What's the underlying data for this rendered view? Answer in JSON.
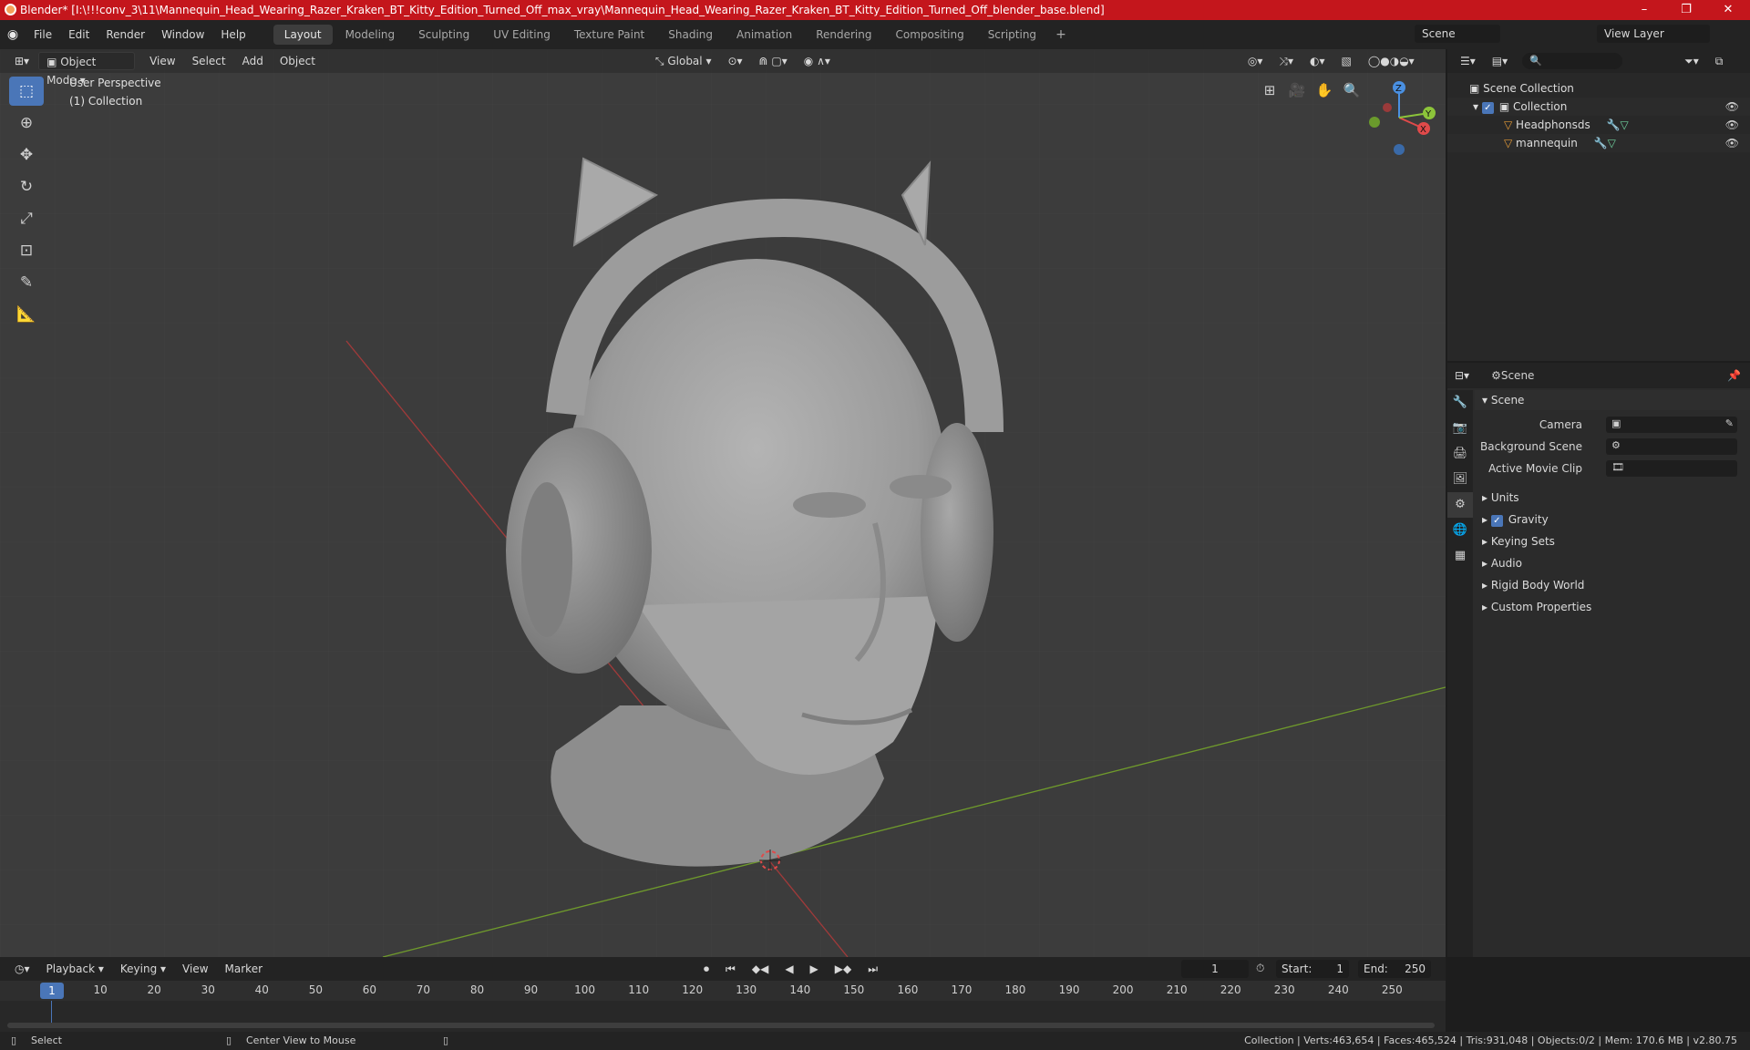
{
  "titlebar": {
    "title": "Blender* [I:\\!!!conv_3\\11\\Mannequin_Head_Wearing_Razer_Kraken_BT_Kitty_Edition_Turned_Off_max_vray\\Mannequin_Head_Wearing_Razer_Kraken_BT_Kitty_Edition_Turned_Off_blender_base.blend]",
    "minimize": "–",
    "maximize": "❐",
    "close": "✕"
  },
  "menu": {
    "items": [
      "File",
      "Edit",
      "Render",
      "Window",
      "Help"
    ]
  },
  "workspaces": {
    "tabs": [
      "Layout",
      "Modeling",
      "Sculpting",
      "UV Editing",
      "Texture Paint",
      "Shading",
      "Animation",
      "Rendering",
      "Compositing",
      "Scripting"
    ],
    "plus": "+"
  },
  "scene_field": "Scene",
  "view_layer_field": "View Layer",
  "viewport": {
    "mode": "Object Mode",
    "menus": [
      "View",
      "Select",
      "Add",
      "Object"
    ],
    "transform": "Global",
    "perspective_label": "User Perspective",
    "collection_label": "(1) Collection",
    "gizmo": {
      "z": "Z",
      "y": "Y",
      "x": "X"
    }
  },
  "outliner": {
    "rows": [
      {
        "label": "Scene Collection"
      },
      {
        "label": "Collection"
      },
      {
        "label": "Headphonsds"
      },
      {
        "label": "mannequin"
      }
    ]
  },
  "properties": {
    "header_label": "Scene",
    "scene_panel": "Scene",
    "camera_label": "Camera",
    "background_scene_label": "Background Scene",
    "active_movie_clip_label": "Active Movie Clip",
    "panels": [
      "Units",
      "Gravity",
      "Keying Sets",
      "Audio",
      "Rigid Body World",
      "Custom Properties"
    ]
  },
  "timeline": {
    "menus": [
      "Playback",
      "Keying",
      "View",
      "Marker"
    ],
    "current_frame": "1",
    "start_label": "Start:",
    "start": "1",
    "end_label": "End:",
    "end": "250",
    "ticks": [
      "10",
      "20",
      "30",
      "40",
      "50",
      "60",
      "70",
      "80",
      "90",
      "100",
      "110",
      "120",
      "130",
      "140",
      "150",
      "160",
      "170",
      "180",
      "190",
      "200",
      "210",
      "220",
      "230",
      "240",
      "250"
    ],
    "ruler_current": "1"
  },
  "statusbar": {
    "select": "Select",
    "center_view": "Center View to Mouse",
    "stats": "Collection | Verts:463,654 | Faces:465,524 | Tris:931,048 | Objects:0/2 | Mem: 170.6 MB | v2.80.75"
  },
  "colors": {
    "accent": "#4a76b8",
    "titlebar": "#c4161c",
    "x_axis": "#e04a4a",
    "y_axis": "#8cc43a",
    "z_axis": "#4a90e2"
  }
}
